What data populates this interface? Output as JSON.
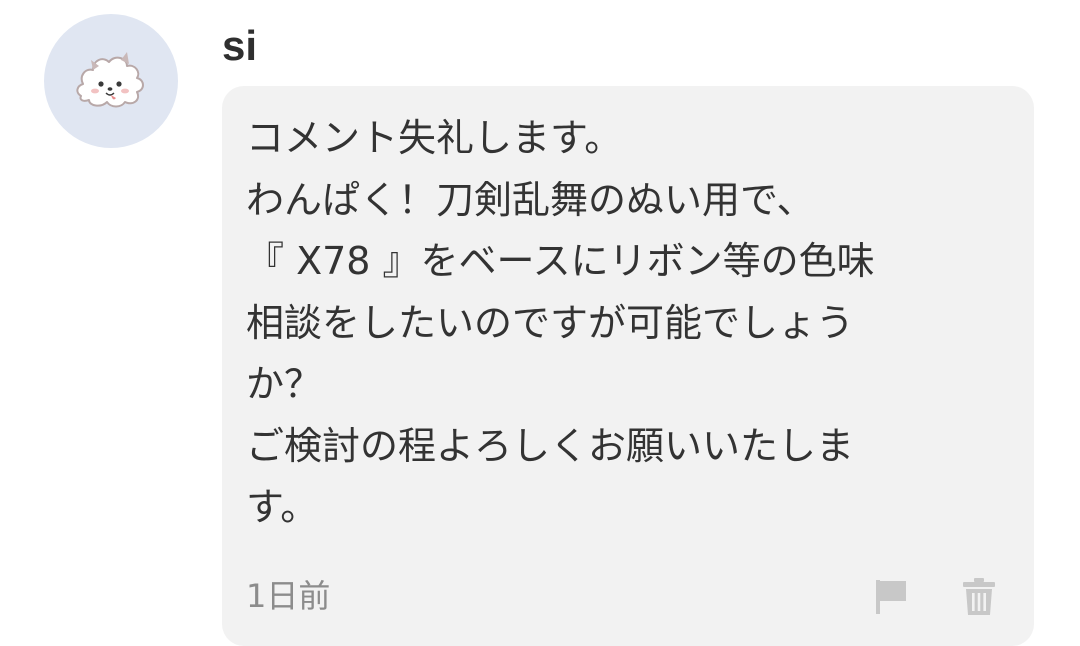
{
  "comment": {
    "username": "si",
    "avatar_icon": "fluffy-dog-icon",
    "message": "コメント失礼します。\nわんぱく！刀剣乱舞のぬい用で、\n『 X78 』をベースにリボン等の色味\n相談をしたいのですが可能でしょう\nか？\nご検討の程よろしくお願いいたしま\nす。",
    "timestamp": "1日前",
    "actions": {
      "report_icon": "flag-icon",
      "delete_icon": "trash-icon"
    }
  },
  "colors": {
    "avatar_bg": "#e0e6f2",
    "bubble_bg": "#f2f2f2",
    "text": "#333333",
    "meta_text": "#8c8c8c",
    "icon_gray": "#c8c8c8"
  }
}
